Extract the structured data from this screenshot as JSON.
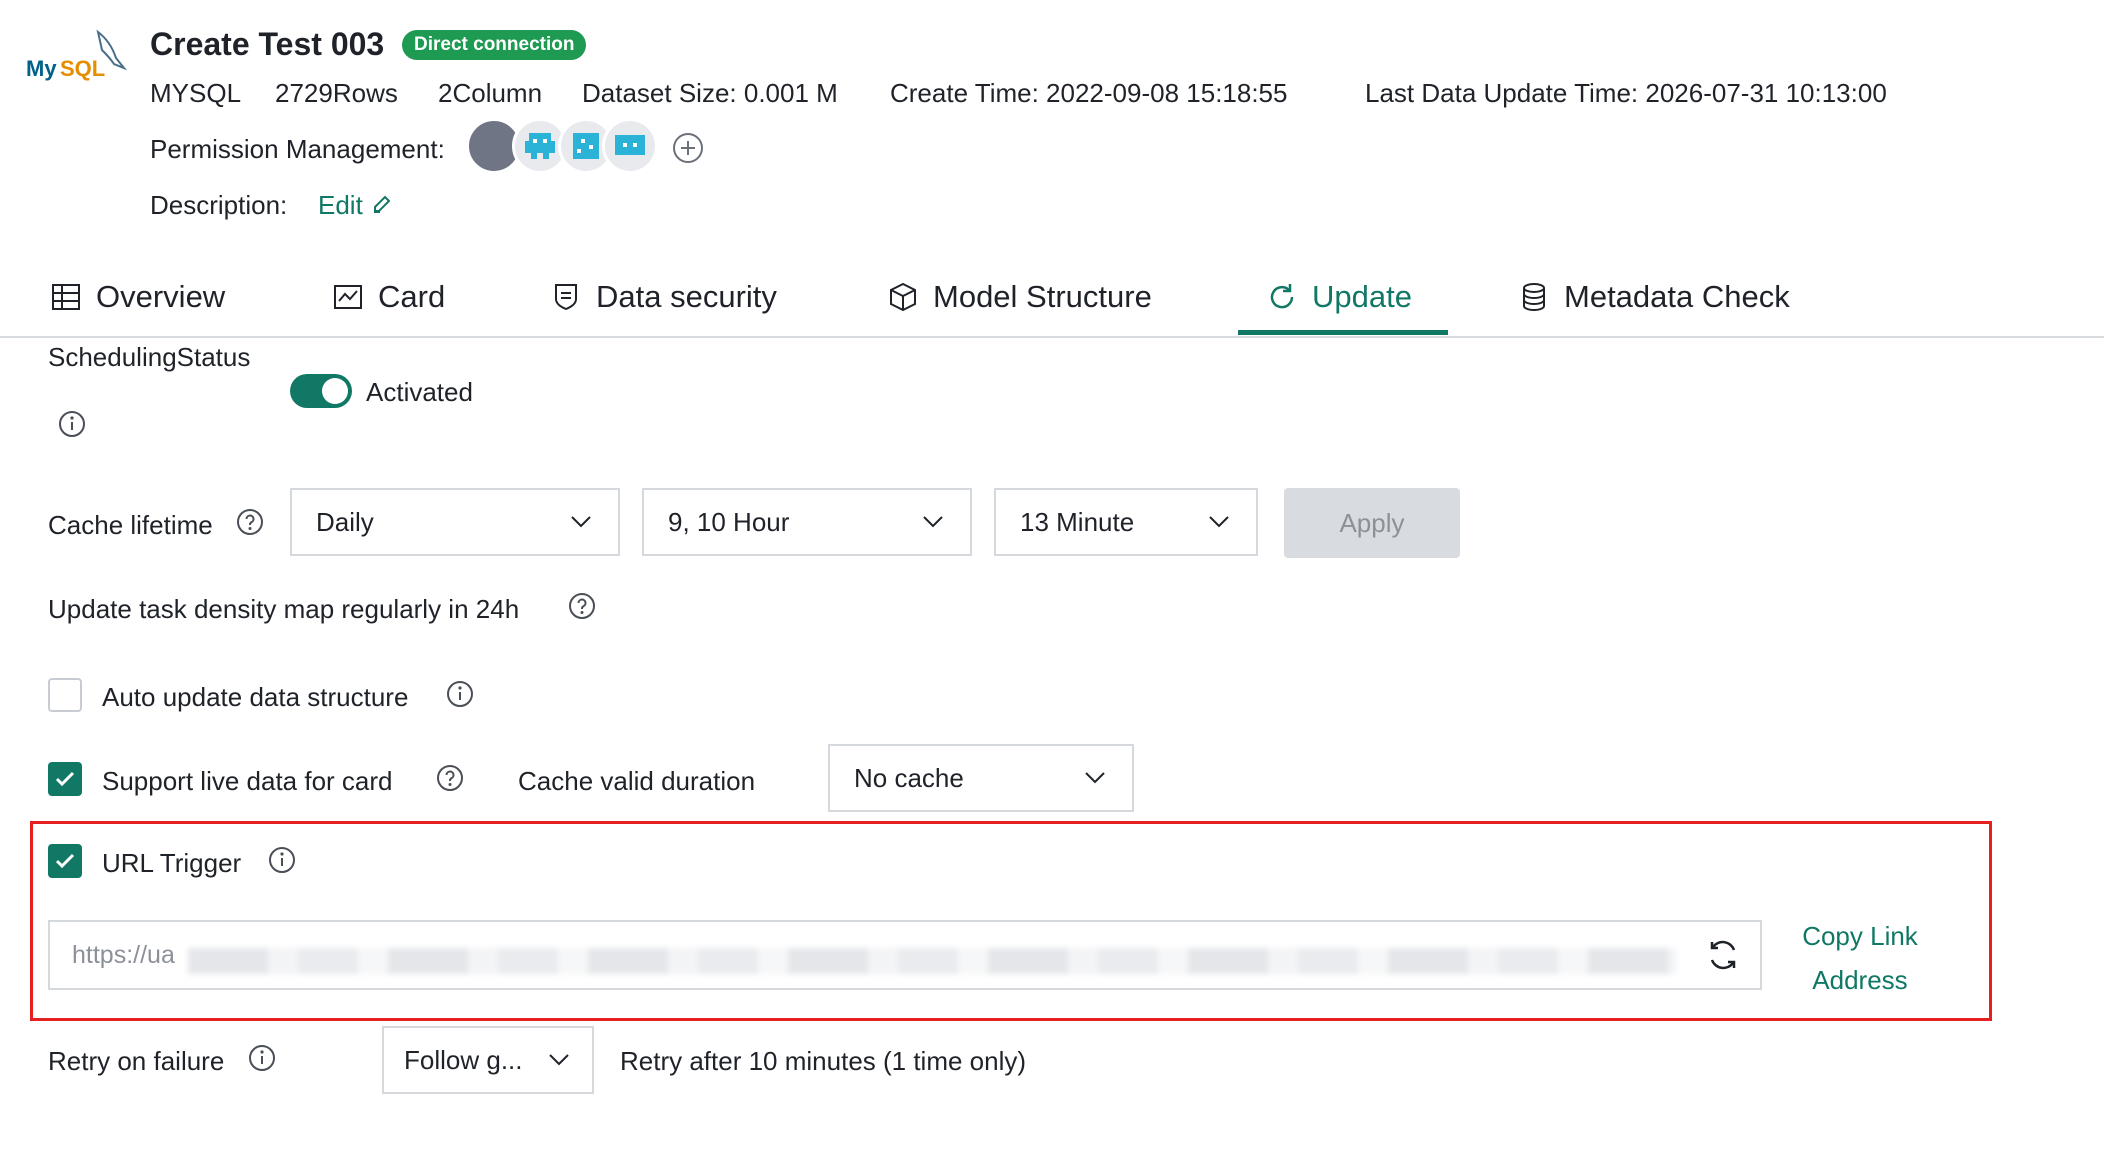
{
  "header": {
    "logo_text": "MySQL",
    "title": "Create Test 003",
    "badge": "Direct connection",
    "meta": {
      "db_type": "MYSQL",
      "rows": "2729Rows",
      "columns": "2Column",
      "dataset_size": "Dataset Size:  0.001 M",
      "create_time": "Create Time:  2022-09-08 15:18:55",
      "last_update": "Last Data Update Time:   2026-07-31 10:13:00"
    },
    "permission_label": "Permission Management:",
    "description_label": "Description:",
    "description_edit": "Edit"
  },
  "tabs": [
    {
      "label": "Overview",
      "icon": "table-icon"
    },
    {
      "label": "Card",
      "icon": "chart-card-icon"
    },
    {
      "label": "Data security",
      "icon": "shield-icon"
    },
    {
      "label": "Model Structure",
      "icon": "cube-icon"
    },
    {
      "label": "Update",
      "icon": "refresh-icon",
      "active": true
    },
    {
      "label": "Metadata Check",
      "icon": "database-icon"
    }
  ],
  "form": {
    "scheduling_status_label": "SchedulingStatus",
    "scheduling_status_value": "Activated",
    "cache_lifetime_label": "Cache lifetime",
    "frequency": "Daily",
    "hour": "9,  10 Hour",
    "minute": "13 Minute",
    "apply": "Apply",
    "density_map": "Update task density map regularly in 24h",
    "auto_update_label": "Auto update data structure",
    "support_live_label": "Support live data for card",
    "cache_valid_label": "Cache valid duration",
    "cache_valid_value": "No cache",
    "url_trigger_label": "URL Trigger",
    "url_value": "https://ua",
    "copy_link": "Copy Link Address",
    "retry_label": "Retry on failure",
    "retry_select": "Follow g...",
    "retry_note": "Retry after 10 minutes (1 time only)"
  },
  "colors": {
    "accent": "#117865",
    "badge": "#1e9a52",
    "highlight": "#e52020"
  }
}
